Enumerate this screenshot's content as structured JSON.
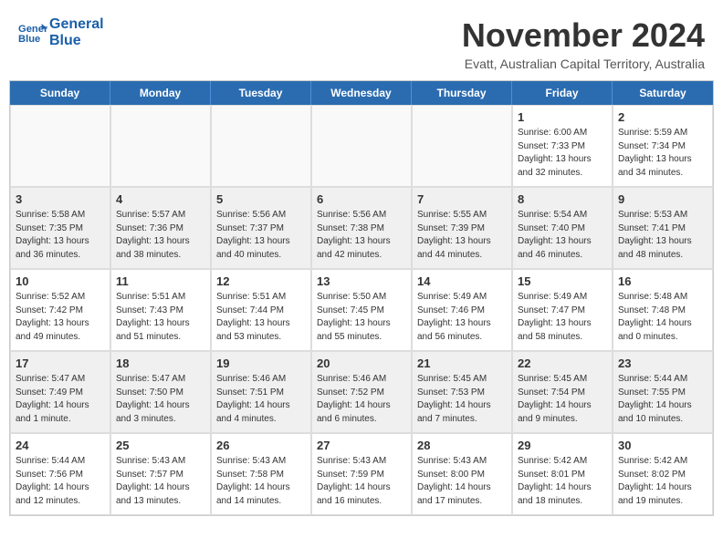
{
  "header": {
    "logo_line1": "General",
    "logo_line2": "Blue",
    "month_title": "November 2024",
    "location": "Evatt, Australian Capital Territory, Australia"
  },
  "calendar": {
    "days_of_week": [
      "Sunday",
      "Monday",
      "Tuesday",
      "Wednesday",
      "Thursday",
      "Friday",
      "Saturday"
    ],
    "weeks": [
      [
        {
          "day": "",
          "info": ""
        },
        {
          "day": "",
          "info": ""
        },
        {
          "day": "",
          "info": ""
        },
        {
          "day": "",
          "info": ""
        },
        {
          "day": "",
          "info": ""
        },
        {
          "day": "1",
          "info": "Sunrise: 6:00 AM\nSunset: 7:33 PM\nDaylight: 13 hours\nand 32 minutes."
        },
        {
          "day": "2",
          "info": "Sunrise: 5:59 AM\nSunset: 7:34 PM\nDaylight: 13 hours\nand 34 minutes."
        }
      ],
      [
        {
          "day": "3",
          "info": "Sunrise: 5:58 AM\nSunset: 7:35 PM\nDaylight: 13 hours\nand 36 minutes."
        },
        {
          "day": "4",
          "info": "Sunrise: 5:57 AM\nSunset: 7:36 PM\nDaylight: 13 hours\nand 38 minutes."
        },
        {
          "day": "5",
          "info": "Sunrise: 5:56 AM\nSunset: 7:37 PM\nDaylight: 13 hours\nand 40 minutes."
        },
        {
          "day": "6",
          "info": "Sunrise: 5:56 AM\nSunset: 7:38 PM\nDaylight: 13 hours\nand 42 minutes."
        },
        {
          "day": "7",
          "info": "Sunrise: 5:55 AM\nSunset: 7:39 PM\nDaylight: 13 hours\nand 44 minutes."
        },
        {
          "day": "8",
          "info": "Sunrise: 5:54 AM\nSunset: 7:40 PM\nDaylight: 13 hours\nand 46 minutes."
        },
        {
          "day": "9",
          "info": "Sunrise: 5:53 AM\nSunset: 7:41 PM\nDaylight: 13 hours\nand 48 minutes."
        }
      ],
      [
        {
          "day": "10",
          "info": "Sunrise: 5:52 AM\nSunset: 7:42 PM\nDaylight: 13 hours\nand 49 minutes."
        },
        {
          "day": "11",
          "info": "Sunrise: 5:51 AM\nSunset: 7:43 PM\nDaylight: 13 hours\nand 51 minutes."
        },
        {
          "day": "12",
          "info": "Sunrise: 5:51 AM\nSunset: 7:44 PM\nDaylight: 13 hours\nand 53 minutes."
        },
        {
          "day": "13",
          "info": "Sunrise: 5:50 AM\nSunset: 7:45 PM\nDaylight: 13 hours\nand 55 minutes."
        },
        {
          "day": "14",
          "info": "Sunrise: 5:49 AM\nSunset: 7:46 PM\nDaylight: 13 hours\nand 56 minutes."
        },
        {
          "day": "15",
          "info": "Sunrise: 5:49 AM\nSunset: 7:47 PM\nDaylight: 13 hours\nand 58 minutes."
        },
        {
          "day": "16",
          "info": "Sunrise: 5:48 AM\nSunset: 7:48 PM\nDaylight: 14 hours\nand 0 minutes."
        }
      ],
      [
        {
          "day": "17",
          "info": "Sunrise: 5:47 AM\nSunset: 7:49 PM\nDaylight: 14 hours\nand 1 minute."
        },
        {
          "day": "18",
          "info": "Sunrise: 5:47 AM\nSunset: 7:50 PM\nDaylight: 14 hours\nand 3 minutes."
        },
        {
          "day": "19",
          "info": "Sunrise: 5:46 AM\nSunset: 7:51 PM\nDaylight: 14 hours\nand 4 minutes."
        },
        {
          "day": "20",
          "info": "Sunrise: 5:46 AM\nSunset: 7:52 PM\nDaylight: 14 hours\nand 6 minutes."
        },
        {
          "day": "21",
          "info": "Sunrise: 5:45 AM\nSunset: 7:53 PM\nDaylight: 14 hours\nand 7 minutes."
        },
        {
          "day": "22",
          "info": "Sunrise: 5:45 AM\nSunset: 7:54 PM\nDaylight: 14 hours\nand 9 minutes."
        },
        {
          "day": "23",
          "info": "Sunrise: 5:44 AM\nSunset: 7:55 PM\nDaylight: 14 hours\nand 10 minutes."
        }
      ],
      [
        {
          "day": "24",
          "info": "Sunrise: 5:44 AM\nSunset: 7:56 PM\nDaylight: 14 hours\nand 12 minutes."
        },
        {
          "day": "25",
          "info": "Sunrise: 5:43 AM\nSunset: 7:57 PM\nDaylight: 14 hours\nand 13 minutes."
        },
        {
          "day": "26",
          "info": "Sunrise: 5:43 AM\nSunset: 7:58 PM\nDaylight: 14 hours\nand 14 minutes."
        },
        {
          "day": "27",
          "info": "Sunrise: 5:43 AM\nSunset: 7:59 PM\nDaylight: 14 hours\nand 16 minutes."
        },
        {
          "day": "28",
          "info": "Sunrise: 5:43 AM\nSunset: 8:00 PM\nDaylight: 14 hours\nand 17 minutes."
        },
        {
          "day": "29",
          "info": "Sunrise: 5:42 AM\nSunset: 8:01 PM\nDaylight: 14 hours\nand 18 minutes."
        },
        {
          "day": "30",
          "info": "Sunrise: 5:42 AM\nSunset: 8:02 PM\nDaylight: 14 hours\nand 19 minutes."
        }
      ]
    ]
  }
}
